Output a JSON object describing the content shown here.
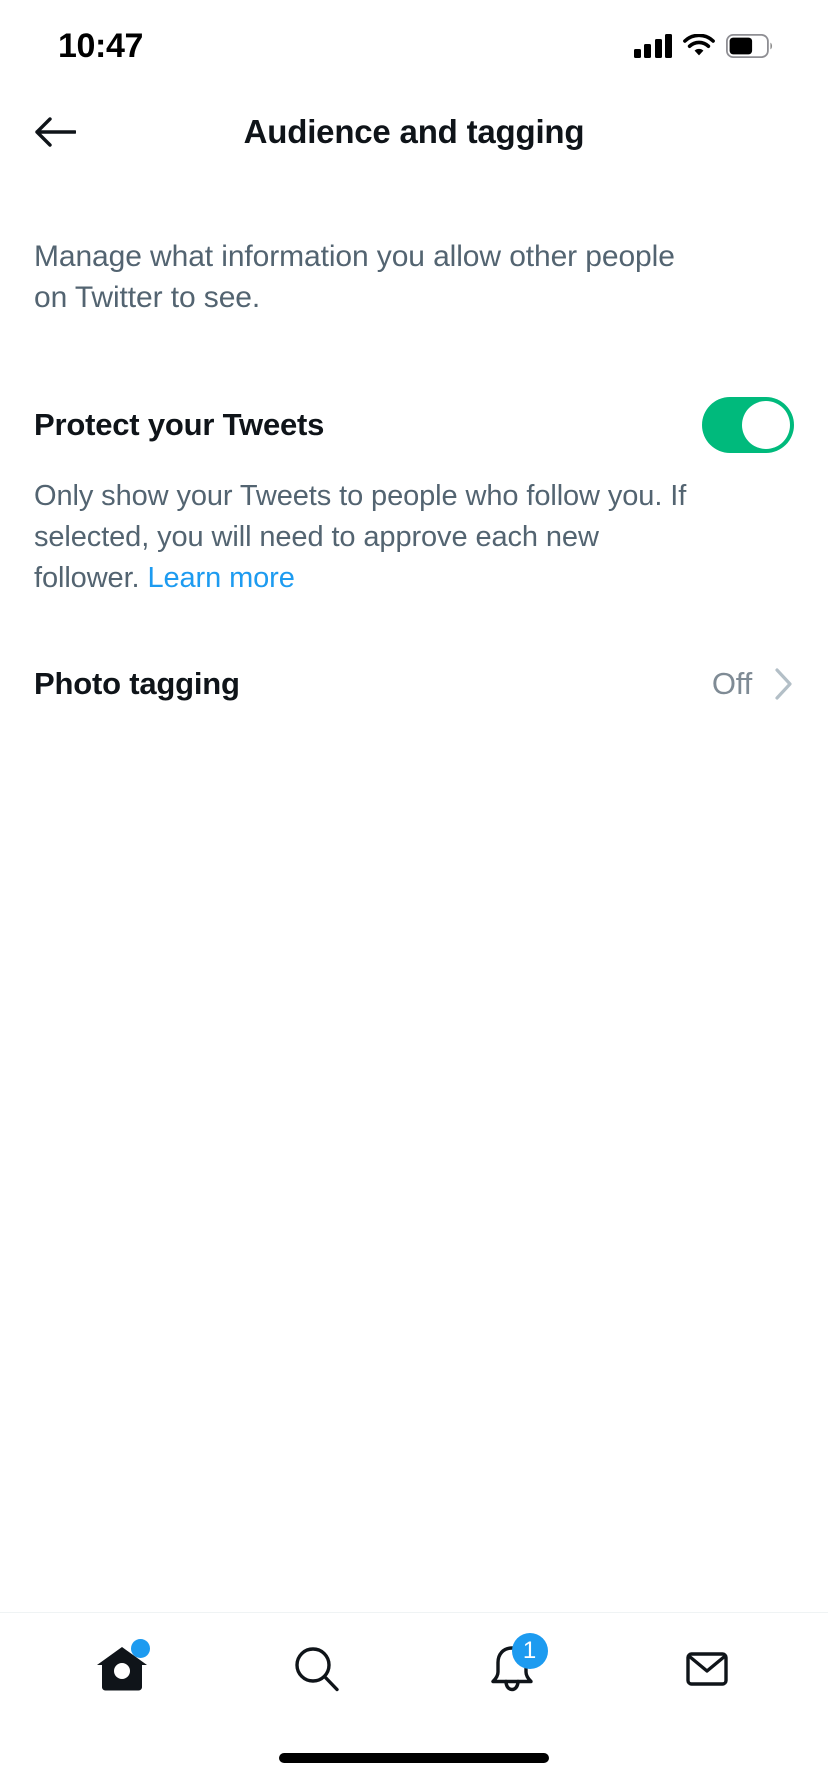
{
  "status_bar": {
    "time": "10:47",
    "cellular_icon": "signal-bars-icon",
    "cellular_bars_filled": 4,
    "wifi_icon": "wifi-icon",
    "battery_icon": "battery-icon",
    "battery_level_percent": 60
  },
  "header": {
    "back_icon": "back-arrow-icon",
    "title": "Audience and tagging"
  },
  "main": {
    "description": "Manage what information you allow other people on Twitter to see.",
    "protect_tweets": {
      "title": "Protect your Tweets",
      "toggle_state": "on",
      "help_text": "Only show your Tweets to people who follow you. If selected, you will need to approve each new follower.",
      "learn_more_label": "Learn more"
    },
    "photo_tagging": {
      "title": "Photo tagging",
      "value": "Off",
      "chevron_icon": "chevron-right-icon"
    }
  },
  "tabbar": {
    "items": [
      {
        "name": "home",
        "icon": "home-icon",
        "badge_type": "dot",
        "badge": ""
      },
      {
        "name": "search",
        "icon": "search-icon",
        "badge_type": "none",
        "badge": ""
      },
      {
        "name": "notifications",
        "icon": "bell-icon",
        "badge_type": "count",
        "badge": "1"
      },
      {
        "name": "messages",
        "icon": "envelope-icon",
        "badge_type": "none",
        "badge": ""
      }
    ]
  },
  "colors": {
    "accent": "#1d9bf0",
    "toggle_on": "#00ba7c",
    "text_primary": "#0f1419",
    "text_secondary": "#536471",
    "value_gray": "#7f8b95"
  }
}
